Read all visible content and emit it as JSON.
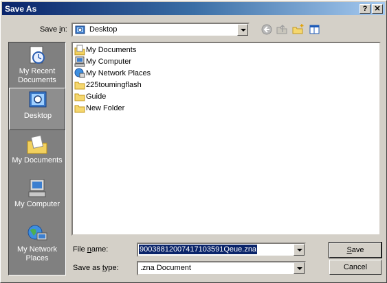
{
  "window": {
    "title": "Save As",
    "help_label": "?",
    "close_label": "✕"
  },
  "save_in": {
    "label_pre": "Save ",
    "label_key": "i",
    "label_post": "n:",
    "value": "Desktop"
  },
  "places": [
    {
      "id": "recent",
      "label_line1": "My Recent",
      "label_line2": "Documents",
      "icon": "recent-documents-icon",
      "selected": false
    },
    {
      "id": "desktop",
      "label_line1": "Desktop",
      "label_line2": "",
      "icon": "desktop-icon",
      "selected": true
    },
    {
      "id": "documents",
      "label_line1": "My Documents",
      "label_line2": "",
      "icon": "my-documents-icon",
      "selected": false
    },
    {
      "id": "computer",
      "label_line1": "My Computer",
      "label_line2": "",
      "icon": "my-computer-icon",
      "selected": false
    },
    {
      "id": "network",
      "label_line1": "My Network",
      "label_line2": "Places",
      "icon": "my-network-icon",
      "selected": false
    }
  ],
  "files": [
    {
      "name": "My Documents",
      "icon": "my-documents-icon"
    },
    {
      "name": "My Computer",
      "icon": "my-computer-icon"
    },
    {
      "name": "My Network Places",
      "icon": "my-network-icon"
    },
    {
      "name": "225toumingflash",
      "icon": "folder-icon"
    },
    {
      "name": "Guide",
      "icon": "folder-icon"
    },
    {
      "name": "New Folder",
      "icon": "folder-icon"
    }
  ],
  "file_name": {
    "label_pre": "File ",
    "label_key": "n",
    "label_post": "ame:",
    "value": "90038812007417103591Qeue.zna"
  },
  "save_as_type": {
    "label_pre": "Save as ",
    "label_key": "t",
    "label_post": "ype:",
    "value": ".zna Document"
  },
  "buttons": {
    "save_key": "S",
    "save_rest": "ave",
    "cancel": "Cancel"
  },
  "colors": {
    "title_start": "#0a246a",
    "title_end": "#a6caf0",
    "selection": "#0a246a",
    "face": "#d4d0c8",
    "places_bg": "#808080"
  }
}
